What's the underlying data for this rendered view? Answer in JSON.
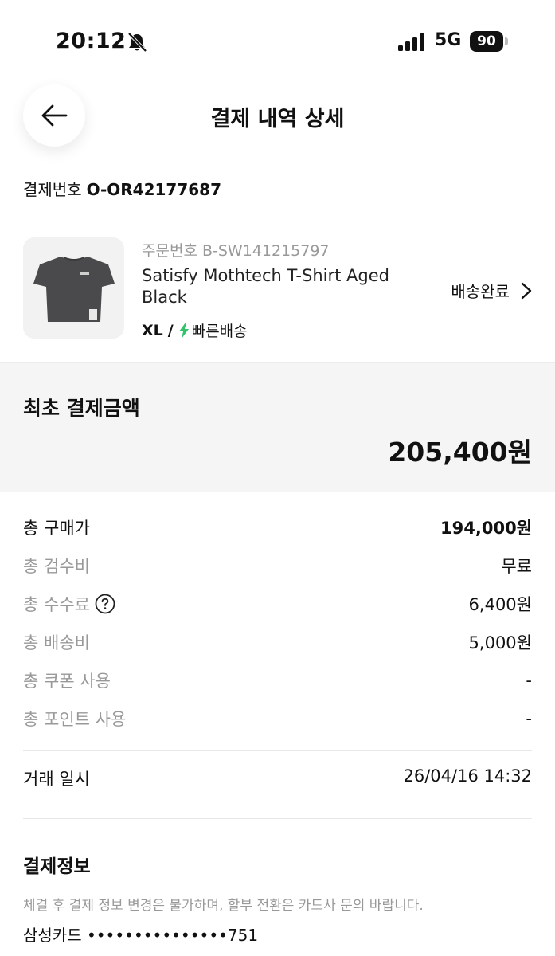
{
  "status_bar": {
    "time": "20:12",
    "network": "5G",
    "battery": "90"
  },
  "header": {
    "title": "결제 내역 상세"
  },
  "payment": {
    "label": "결제번호",
    "number": "O-OR42177687"
  },
  "product": {
    "order_no": "주문번호 B-SW141215797",
    "name": "Satisfy Mothtech T-Shirt Aged Black",
    "size": "XL",
    "separator": "/",
    "shipping_type": "빠른배송",
    "status": "배송완료",
    "accent_color": "#33c26b"
  },
  "total": {
    "label": "최초 결제금액",
    "amount": "205,400원"
  },
  "breakdown": [
    {
      "label": "총 구매가",
      "value": "194,000원"
    },
    {
      "label": "총 검수비",
      "value": "무료"
    },
    {
      "label": "총 수수료",
      "value": "6,400원"
    },
    {
      "label": "총 배송비",
      "value": "5,000원"
    },
    {
      "label": "총 쿠폰 사용",
      "value": "-"
    },
    {
      "label": "총 포인트 사용",
      "value": "-"
    }
  ],
  "trade": {
    "label": "거래 일시",
    "value": "26/04/16 14:32"
  },
  "payment_info": {
    "title": "결제정보",
    "note": "체결 후 결제 정보 변경은 불가하며, 할부 전환은 카드사 문의 바랍니다.",
    "card": "삼성카드 •••••••••••••••751"
  }
}
